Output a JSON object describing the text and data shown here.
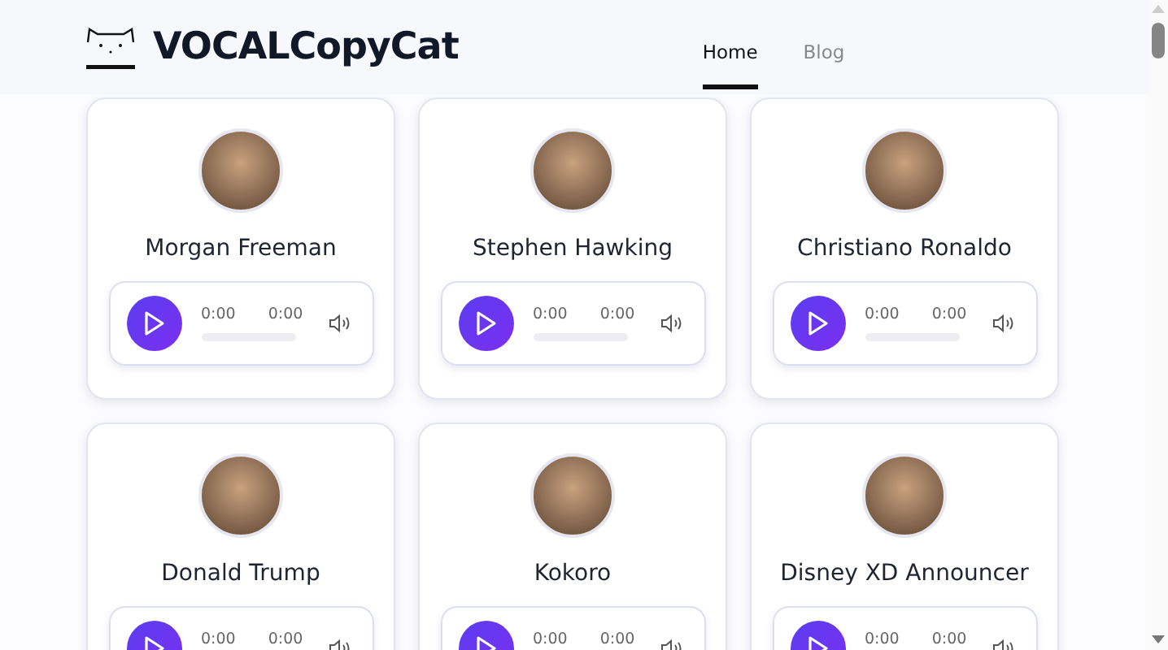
{
  "header": {
    "brand": "VOCALCopyCat",
    "nav": [
      {
        "label": "Home",
        "selected": true
      },
      {
        "label": "Blog",
        "selected": false
      }
    ]
  },
  "voices": [
    {
      "name": "Morgan Freeman",
      "current": "0:00",
      "duration": "0:00",
      "level": 0
    },
    {
      "name": "Stephen Hawking",
      "current": "0:00",
      "duration": "0:00",
      "level": 0
    },
    {
      "name": "Christiano Ronaldo",
      "current": "0:00",
      "duration": "0:00",
      "level": 0
    },
    {
      "name": "Donald Trump",
      "current": "0:00",
      "duration": "0:00"
    },
    {
      "name": "Kokoro",
      "current": "0:00",
      "duration": "0:00"
    },
    {
      "name": "Disney XD Announcer",
      "current": "0:00",
      "duration": "0:00"
    }
  ]
}
